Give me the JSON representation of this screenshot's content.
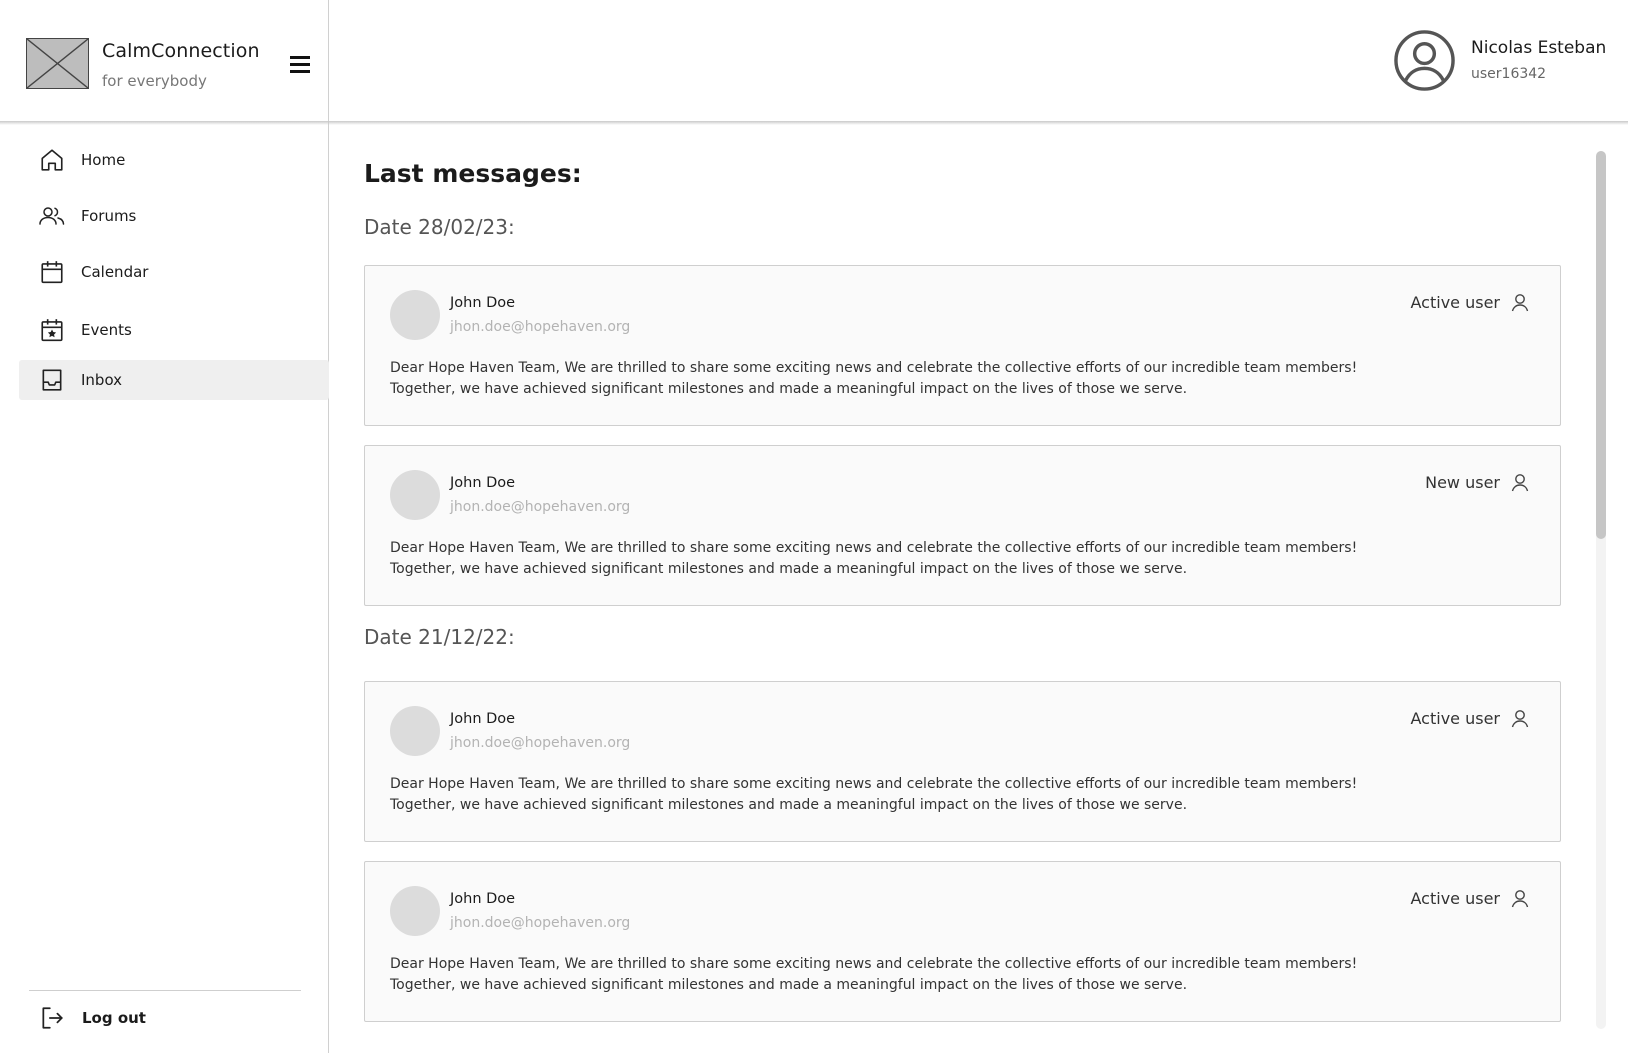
{
  "brand": {
    "name": "CalmConnection",
    "tagline": "for everybody"
  },
  "user": {
    "name": "Nicolas Esteban",
    "id": "user16342"
  },
  "nav": {
    "items": [
      {
        "label": "Home",
        "icon": "home-icon"
      },
      {
        "label": "Forums",
        "icon": "users-icon"
      },
      {
        "label": "Calendar",
        "icon": "calendar-icon"
      },
      {
        "label": "Events",
        "icon": "event-star-icon"
      },
      {
        "label": "Inbox",
        "icon": "inbox-icon",
        "active": true
      }
    ],
    "logout_label": "Log out"
  },
  "main": {
    "title": "Last messages:",
    "groups": [
      {
        "date": "Date 28/02/23:",
        "messages": [
          {
            "name": "John Doe",
            "email": "jhon.doe@hopehaven.org",
            "status": "Active user",
            "body": "Dear Hope Haven Team, We are thrilled to share some exciting news and celebrate the collective efforts of our incredible team members! Together, we have achieved significant milestones and made a meaningful impact on the lives of those we serve."
          },
          {
            "name": "John Doe",
            "email": "jhon.doe@hopehaven.org",
            "status": "New user",
            "body": "Dear Hope Haven Team, We are thrilled to share some exciting news and celebrate the collective efforts of our incredible team members! Together, we have achieved significant milestones and made a meaningful impact on the lives of those we serve."
          }
        ]
      },
      {
        "date": "Date 21/12/22:",
        "messages": [
          {
            "name": "John Doe",
            "email": "jhon.doe@hopehaven.org",
            "status": "Active user",
            "body": "Dear Hope Haven Team, We are thrilled to share some exciting news and celebrate the collective efforts of our incredible team members! Together, we have achieved significant milestones and made a meaningful impact on the lives of those we serve."
          },
          {
            "name": "John Doe",
            "email": "jhon.doe@hopehaven.org",
            "status": "Active user",
            "body": "Dear Hope Haven Team, We are thrilled to share some exciting news and celebrate the collective efforts of our incredible team members! Together, we have achieved significant milestones and made a meaningful impact on the lives of those we serve."
          }
        ]
      }
    ]
  }
}
